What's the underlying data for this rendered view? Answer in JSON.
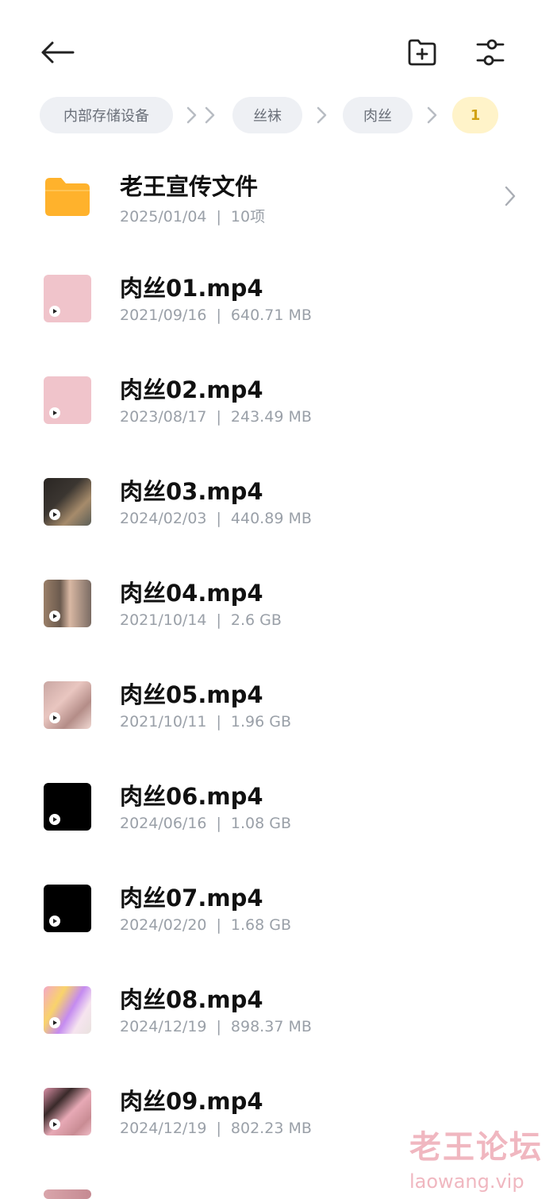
{
  "breadcrumb": [
    "内部存储设备",
    "丝袜",
    "肉丝",
    "1"
  ],
  "folder": {
    "name": "老王宣传文件",
    "date": "2025/01/04",
    "count": "10项"
  },
  "files": [
    {
      "name": "肉丝01.mp4",
      "date": "2021/09/16",
      "size": "640.71 MB"
    },
    {
      "name": "肉丝02.mp4",
      "date": "2023/08/17",
      "size": "243.49 MB"
    },
    {
      "name": "肉丝03.mp4",
      "date": "2024/02/03",
      "size": "440.89 MB"
    },
    {
      "name": "肉丝04.mp4",
      "date": "2021/10/14",
      "size": "2.6 GB"
    },
    {
      "name": "肉丝05.mp4",
      "date": "2021/10/11",
      "size": "1.96 GB"
    },
    {
      "name": "肉丝06.mp4",
      "date": "2024/06/16",
      "size": "1.08 GB"
    },
    {
      "name": "肉丝07.mp4",
      "date": "2024/02/20",
      "size": "1.68 GB"
    },
    {
      "name": "肉丝08.mp4",
      "date": "2024/12/19",
      "size": "898.37 MB"
    },
    {
      "name": "肉丝09.mp4",
      "date": "2024/12/19",
      "size": "802.23 MB"
    }
  ],
  "separator": "|",
  "watermark": {
    "title": "老王论坛",
    "url": "laowang.vip"
  },
  "colors": {
    "folder": "#FFB22C",
    "chip_bg": "#EEF0F4",
    "active_chip_bg": "#FFF3C9",
    "active_chip_text": "#D1A215"
  }
}
